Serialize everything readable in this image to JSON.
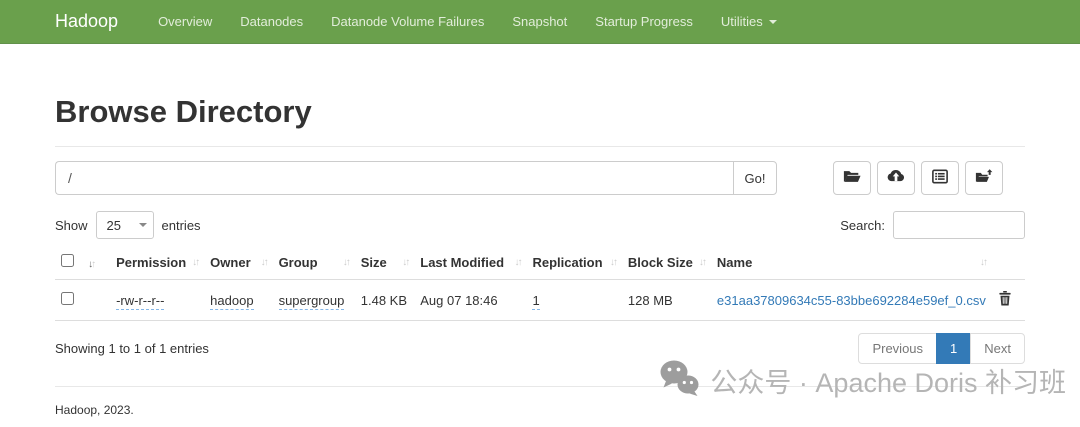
{
  "navbar": {
    "brand": "Hadoop",
    "items": [
      {
        "label": "Overview"
      },
      {
        "label": "Datanodes"
      },
      {
        "label": "Datanode Volume Failures"
      },
      {
        "label": "Snapshot"
      },
      {
        "label": "Startup Progress"
      },
      {
        "label": "Utilities",
        "has_dropdown": true
      }
    ],
    "bg_color": "#6aa04c"
  },
  "page": {
    "title": "Browse Directory"
  },
  "path_bar": {
    "value": "/",
    "go_label": "Go!",
    "icon_buttons": [
      "folder-open-icon",
      "cloud-upload-icon",
      "list-alt-icon",
      "folder-move-icon"
    ]
  },
  "table_controls": {
    "show_label": "Show",
    "page_size": "25",
    "entries_label": "entries",
    "search_label": "Search:",
    "search_value": ""
  },
  "table": {
    "headers": {
      "permission": "Permission",
      "owner": "Owner",
      "group": "Group",
      "size": "Size",
      "last_modified": "Last Modified",
      "replication": "Replication",
      "block_size": "Block Size",
      "name": "Name"
    },
    "rows": [
      {
        "permission": "-rw-r--r--",
        "owner": "hadoop",
        "group": "supergroup",
        "size": "1.48 KB",
        "last_modified": "Aug 07 18:46",
        "replication": "1",
        "block_size": "128 MB",
        "name": "e31aa37809634c55-83bbe692284e59ef_0.csv"
      }
    ]
  },
  "table_footer": {
    "info": "Showing 1 to 1 of 1 entries",
    "previous_label": "Previous",
    "page": "1",
    "next_label": "Next"
  },
  "footer": {
    "text": "Hadoop, 2023."
  },
  "watermark": {
    "text": "公众号 · Apache Doris 补习班"
  },
  "colors": {
    "navbar_green": "#6aa04c",
    "link_blue": "#337ab7",
    "active_page_bg": "#337ab7",
    "dashed_underline": "#85b7e8",
    "watermark_grey": "#b5b5b5"
  }
}
